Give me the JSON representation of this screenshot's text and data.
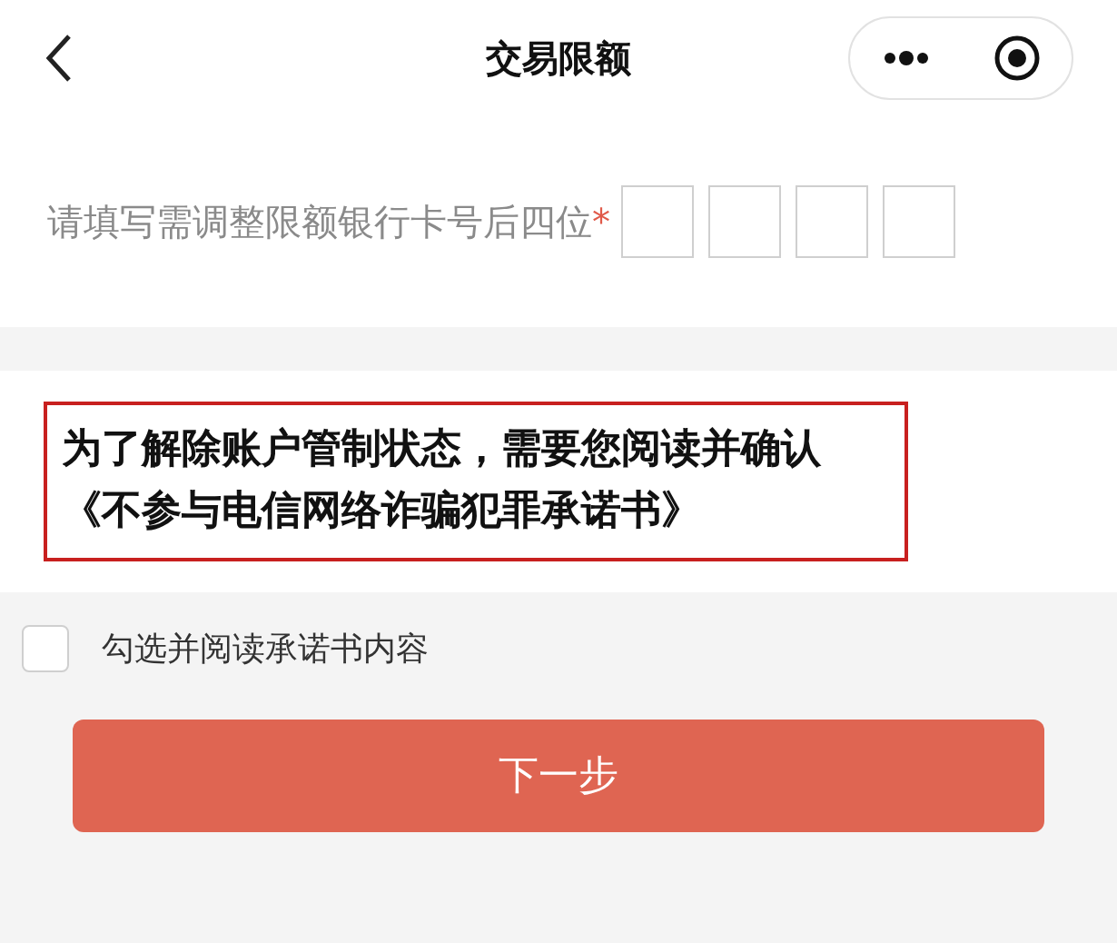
{
  "header": {
    "title": "交易限额"
  },
  "card_field": {
    "label": "请填写需调整限额银行卡号后四位",
    "required_mark": "*"
  },
  "notice": {
    "text": "为了解除账户管制状态，需要您阅读并确认《不参与电信网络诈骗犯罪承诺书》",
    "highlighted": true
  },
  "agreement": {
    "label": "勾选并阅读承诺书内容",
    "checked": false
  },
  "next_button": {
    "label": "下一步"
  }
}
